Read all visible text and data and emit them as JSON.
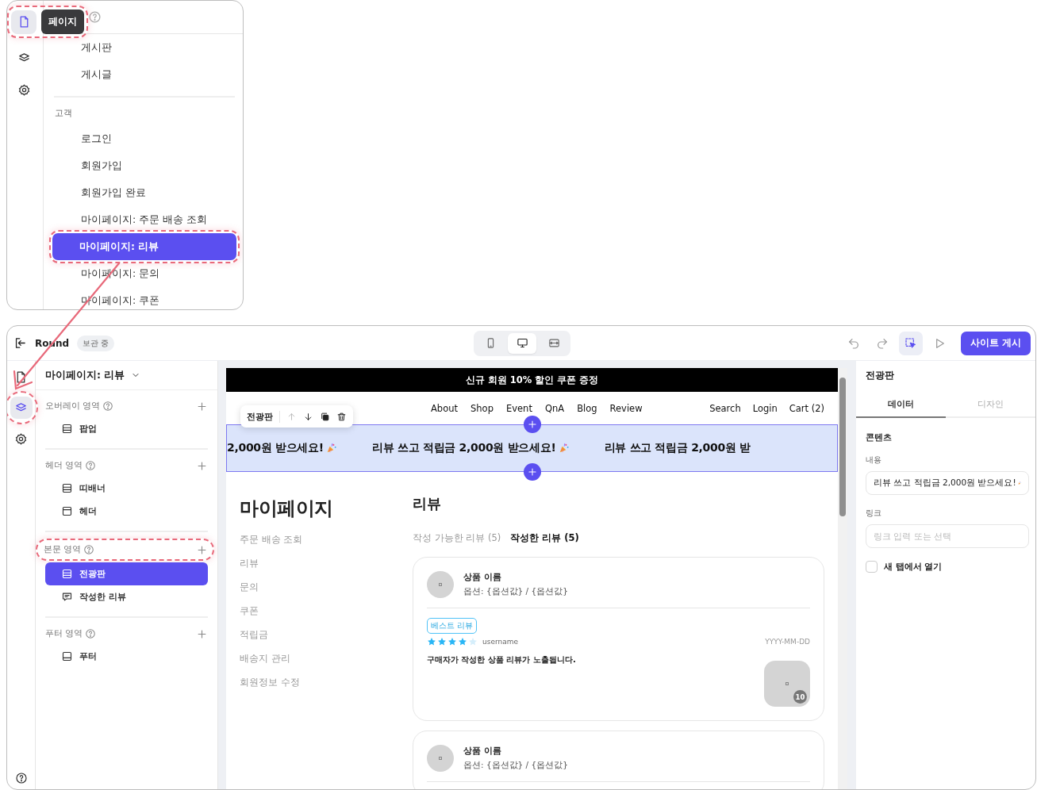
{
  "inset": {
    "tooltip": "페이지",
    "rail": [
      {
        "kind": "pages",
        "selected": true,
        "highlighted": true
      },
      {
        "kind": "layers",
        "selected": false,
        "highlighted": false
      },
      {
        "kind": "settings",
        "selected": false,
        "highlighted": false
      }
    ],
    "sections": [
      {
        "items": [
          {
            "label": "게시판",
            "selected": false,
            "highlighted": false
          },
          {
            "label": "게시글",
            "selected": false,
            "highlighted": false
          }
        ]
      },
      {
        "title": "고객",
        "items": [
          {
            "label": "로그인",
            "selected": false,
            "highlighted": false
          },
          {
            "label": "회원가입",
            "selected": false,
            "highlighted": false
          },
          {
            "label": "회원가입 완료",
            "selected": false,
            "highlighted": false
          },
          {
            "label": "마이페이지: 주문 배송 조회",
            "selected": false,
            "highlighted": false
          },
          {
            "label": "마이페이지: 리뷰",
            "selected": true,
            "highlighted": true
          },
          {
            "label": "마이페이지: 문의",
            "selected": false,
            "highlighted": false
          },
          {
            "label": "마이페이지: 쿠폰",
            "selected": false,
            "highlighted": false
          }
        ]
      }
    ]
  },
  "toolbar": {
    "site_name": "Round",
    "status": "보관 중",
    "devices": [
      {
        "kind": "mobile",
        "selected": false
      },
      {
        "kind": "desktop",
        "selected": true
      },
      {
        "kind": "responsive",
        "selected": false
      }
    ],
    "tools": [
      {
        "kind": "undo",
        "active": false
      },
      {
        "kind": "redo",
        "active": false
      },
      {
        "kind": "select",
        "active": true
      },
      {
        "kind": "preview",
        "active": false
      }
    ],
    "publish": "사이트 게시"
  },
  "rail": [
    {
      "kind": "pages",
      "selected": false,
      "highlighted": false
    },
    {
      "kind": "layers",
      "selected": true,
      "highlighted": true
    },
    {
      "kind": "settings",
      "selected": false,
      "highlighted": false
    }
  ],
  "layers": {
    "page_title": "마이페이지: 리뷰",
    "sections": [
      {
        "title": "오버레이 영역",
        "highlighted": false,
        "items": [
          {
            "label": "팝업",
            "kind": "section",
            "selected": false
          }
        ]
      },
      {
        "title": "헤더 영역",
        "highlighted": false,
        "items": [
          {
            "label": "띠배너",
            "kind": "section",
            "selected": false
          },
          {
            "label": "헤더",
            "kind": "header",
            "selected": false
          }
        ]
      },
      {
        "title": "본문 영역",
        "highlighted": true,
        "items": [
          {
            "label": "전광판",
            "kind": "section",
            "selected": true
          },
          {
            "label": "작성한 리뷰",
            "kind": "comment",
            "selected": false
          }
        ]
      },
      {
        "title": "푸터 영역",
        "highlighted": false,
        "items": [
          {
            "label": "푸터",
            "kind": "footer",
            "selected": false
          }
        ]
      }
    ]
  },
  "canvas": {
    "announcement": "신규 회원 10% 할인 쿠폰 증정",
    "nav": [
      "About",
      "Shop",
      "Event",
      "QnA",
      "Blog",
      "Review"
    ],
    "nav_right": [
      "Search",
      "Login",
      "Cart (2)"
    ],
    "marquee": [
      "2,000원 받으세요!",
      "리뷰 쓰고 적립금 2,000원 받으세요!",
      "리뷰 쓰고 적립금 2,000원 받"
    ],
    "block_toolbar": {
      "label": "전광판",
      "actions": [
        {
          "kind": "up",
          "disabled": true
        },
        {
          "kind": "down",
          "disabled": false
        },
        {
          "kind": "copy",
          "disabled": false
        },
        {
          "kind": "delete",
          "disabled": false
        }
      ]
    },
    "page_heading": "마이페이지",
    "menu": [
      "주문 배송 조회",
      "리뷰",
      "문의",
      "쿠폰",
      "적립금",
      "배송지 관리",
      "회원정보 수정"
    ],
    "section_title": "리뷰",
    "tabs": [
      {
        "label": "작성 가능한 리뷰 (5)",
        "selected": false
      },
      {
        "label": "작성한 리뷰 (5)",
        "selected": true
      }
    ],
    "reviews": [
      {
        "product": "상품 이름",
        "option": "옵션: {옵션값} / {옵션값}",
        "badge": "베스트 리뷰",
        "stars": 4,
        "user": "username",
        "date": "YYYY-MM-DD",
        "text": "구매자가 작성한 상품 리뷰가 노출됩니다.",
        "photo_count": "10"
      },
      {
        "product": "상품 이름",
        "option": "옵션: {옵션값} / {옵션값}"
      }
    ]
  },
  "inspector": {
    "title": "전광판",
    "tabs": [
      {
        "label": "데이터",
        "selected": true
      },
      {
        "label": "디자인",
        "selected": false
      }
    ],
    "section": "콘텐츠",
    "content_label": "내용",
    "content_value": "리뷰 쓰고 적립금 2,000원 받으세요!",
    "link_label": "링크",
    "link_placeholder": "링크 입력 또는 선택",
    "new_tab": {
      "label": "새 탭에서 열기",
      "checked": false
    }
  }
}
